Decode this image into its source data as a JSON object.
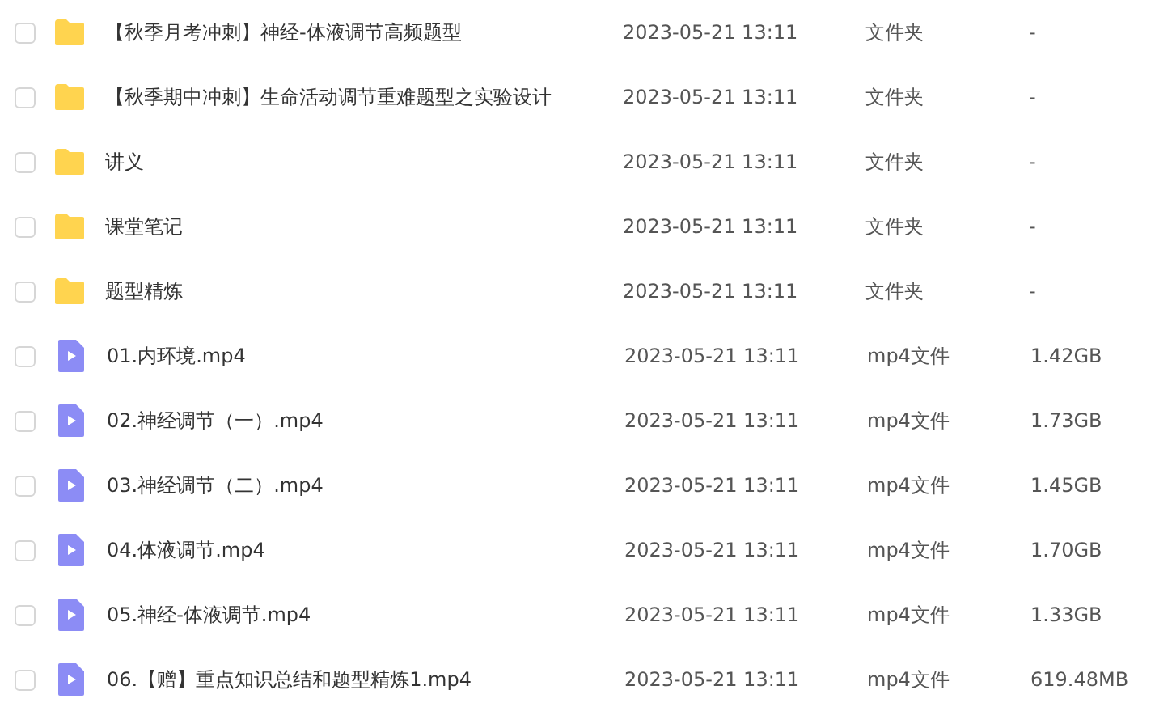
{
  "files": [
    {
      "kind": "folder",
      "name": "【秋季月考冲刺】神经-体液调节高频题型",
      "modified": "2023-05-21 13:11",
      "type": "文件夹",
      "size": "-",
      "checked": false
    },
    {
      "kind": "folder",
      "name": "【秋季期中冲刺】生命活动调节重难题型之实验设计",
      "modified": "2023-05-21 13:11",
      "type": "文件夹",
      "size": "-",
      "checked": false
    },
    {
      "kind": "folder",
      "name": "讲义",
      "modified": "2023-05-21 13:11",
      "type": "文件夹",
      "size": "-",
      "checked": false
    },
    {
      "kind": "folder",
      "name": "课堂笔记",
      "modified": "2023-05-21 13:11",
      "type": "文件夹",
      "size": "-",
      "checked": false
    },
    {
      "kind": "folder",
      "name": "题型精炼",
      "modified": "2023-05-21 13:11",
      "type": "文件夹",
      "size": "-",
      "checked": false
    },
    {
      "kind": "video",
      "name": "01.内环境.mp4",
      "modified": "2023-05-21 13:11",
      "type": "mp4文件",
      "size": "1.42GB",
      "checked": false
    },
    {
      "kind": "video",
      "name": "02.神经调节（一）.mp4",
      "modified": "2023-05-21 13:11",
      "type": "mp4文件",
      "size": "1.73GB",
      "checked": false
    },
    {
      "kind": "video",
      "name": "03.神经调节（二）.mp4",
      "modified": "2023-05-21 13:11",
      "type": "mp4文件",
      "size": "1.45GB",
      "checked": false
    },
    {
      "kind": "video",
      "name": "04.体液调节.mp4",
      "modified": "2023-05-21 13:11",
      "type": "mp4文件",
      "size": "1.70GB",
      "checked": false
    },
    {
      "kind": "video",
      "name": "05.神经-体液调节.mp4",
      "modified": "2023-05-21 13:11",
      "type": "mp4文件",
      "size": "1.33GB",
      "checked": false
    },
    {
      "kind": "video",
      "name": "06.【赠】重点知识总结和题型精炼1.mp4",
      "modified": "2023-05-21 13:11",
      "type": "mp4文件",
      "size": "619.48MB",
      "checked": false
    }
  ]
}
